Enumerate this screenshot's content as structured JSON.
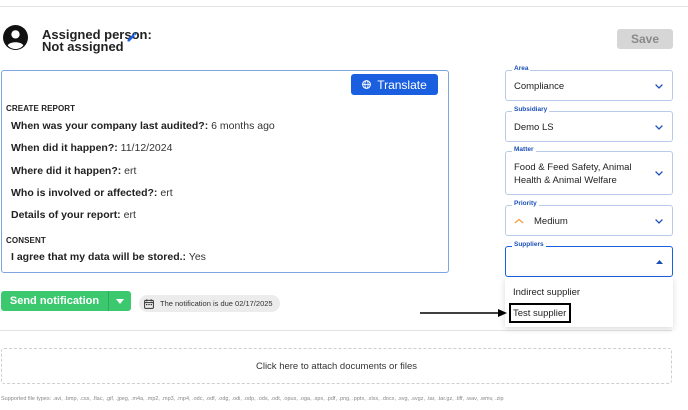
{
  "assigned": {
    "label": "Assigned person:",
    "value": "Not assigned"
  },
  "toolbar": {
    "save_label": "Save"
  },
  "report": {
    "translate_label": "Translate",
    "section_create": "CREATE REPORT",
    "section_consent": "CONSENT",
    "items": [
      {
        "q": "When was your company last audited?:",
        "a": "6 months ago"
      },
      {
        "q": "When did it happen?:",
        "a": "11/12/2024"
      },
      {
        "q": "Where did it happen?:",
        "a": "ert"
      },
      {
        "q": "Who is involved or affected?:",
        "a": "ert"
      },
      {
        "q": "Details of your report:",
        "a": "ert"
      }
    ],
    "consent": {
      "q": "I agree that my data will be stored.:",
      "a": "Yes"
    }
  },
  "notification": {
    "send_label": "Send notification",
    "due_text": "The notification is due 02/17/2025"
  },
  "attach": {
    "label": "Click here to attach documents or files",
    "file_types": "Supported file types: .avi, .bmp, .css, .flac, .gif, .jpeg, .m4a, .mp2, .mp3, .mp4, .odc, .odf, .odg, .odi, .odp, .ods, .odt, .opus, .oga, .spx, .pdf, .png, .pptx, .xlsx, .docx, .svg, .svgz, .tar, .tar.gz, .tiff, .wav, .wmv, .zip"
  },
  "fields": {
    "area": {
      "label": "Area",
      "value": "Compliance"
    },
    "subsidiary": {
      "label": "Subsidiary",
      "value": "Demo LS"
    },
    "matter": {
      "label": "Matter",
      "value_line1": "Food & Feed Safety, Animal",
      "value_line2": "Health & Animal Welfare"
    },
    "priority": {
      "label": "Priority",
      "value": "Medium"
    },
    "suppliers": {
      "label": "Suppliers",
      "options": [
        "Indirect supplier",
        "Test supplier"
      ]
    }
  },
  "colors": {
    "primary": "#1a5fe0",
    "success": "#3cc86e",
    "field_label": "#1a4fb8",
    "priority_medium": "#f0a04b"
  }
}
